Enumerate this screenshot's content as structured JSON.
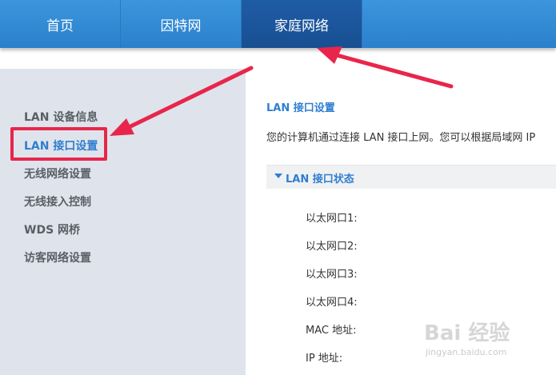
{
  "nav": {
    "tabs": [
      {
        "label": "首页"
      },
      {
        "label": "因特网"
      },
      {
        "label": "家庭网络"
      }
    ],
    "active_tab": "家庭网络"
  },
  "sidebar": {
    "items": [
      {
        "label": "LAN 设备信息"
      },
      {
        "label": "LAN 接口设置"
      },
      {
        "label": "无线网络设置"
      },
      {
        "label": "无线接入控制"
      },
      {
        "label": "WDS 网桥"
      },
      {
        "label": "访客网络设置"
      }
    ],
    "active_item": "LAN 接口设置"
  },
  "main": {
    "title": "LAN 接口设置",
    "description": "您的计算机通过连接 LAN 接口上网。您可以根据局域网 IP",
    "section": {
      "title": "LAN 接口状态",
      "fields": [
        {
          "label": "以太网口1:"
        },
        {
          "label": "以太网口2:"
        },
        {
          "label": "以太网口3:"
        },
        {
          "label": "以太网口4:"
        },
        {
          "label": "MAC 地址:"
        },
        {
          "label": "IP 地址:"
        }
      ]
    }
  },
  "watermark": {
    "brand": "Bai 经验",
    "url": "jingyan.baidu.com"
  },
  "colors": {
    "nav_bg": "#2b80cc",
    "nav_active": "#1f5ca6",
    "accent": "#2f7fd0",
    "highlight": "#e8264b",
    "sidebar_bg": "#dfe4ec"
  }
}
